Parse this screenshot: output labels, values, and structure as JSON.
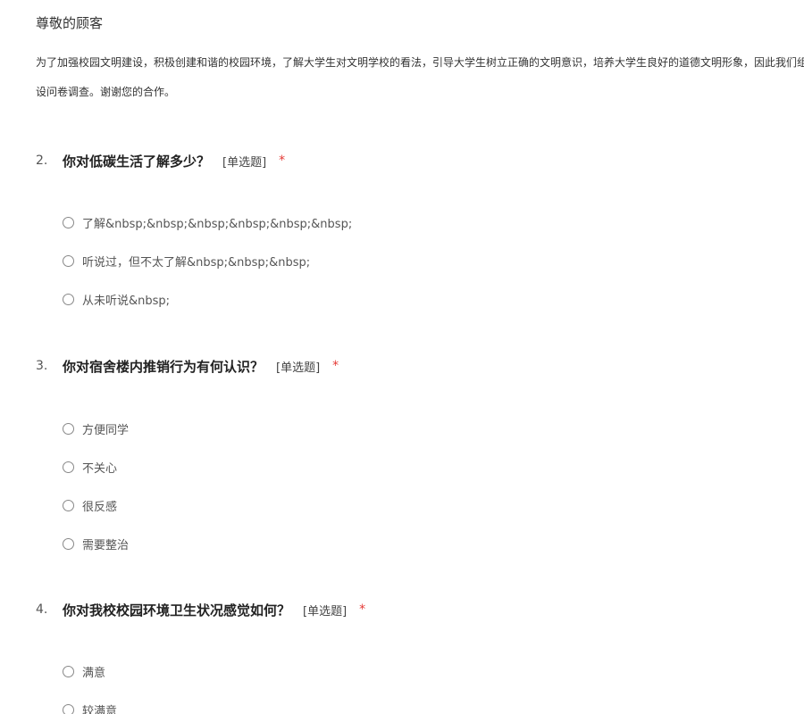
{
  "header": {
    "greeting": "尊敬的顾客",
    "intro_line1": "为了加强校园文明建设，积极创建和谐的校园环境，了解大学生对文明学校的看法，引导大学生树立正确的文明意识，培养大学生良好的道德文明形象，因此我们组织了此次文明校园建",
    "intro_line2": "设问卷调查。谢谢您的合作。"
  },
  "questions": [
    {
      "number": "2.",
      "title": "你对低碳生活了解多少？",
      "type_label": "[单选题]",
      "required_mark": "*",
      "options": [
        "了解&nbsp;&nbsp;&nbsp;&nbsp;&nbsp;&nbsp;",
        "听说过，但不太了解&nbsp;&nbsp;&nbsp;",
        "从未听说&nbsp;"
      ]
    },
    {
      "number": "3.",
      "title": "你对宿舍楼内推销行为有何认识？",
      "type_label": "[单选题]",
      "required_mark": "*",
      "options": [
        "方便同学",
        "不关心",
        "很反感",
        "需要整治"
      ]
    },
    {
      "number": "4.",
      "title": "你对我校校园环境卫生状况感觉如何？",
      "type_label": "[单选题]",
      "required_mark": "*",
      "options": [
        "满意",
        "较满意"
      ]
    }
  ],
  "colors": {
    "required": "#e53935",
    "radio_border": "#888888",
    "text": "#333333"
  }
}
